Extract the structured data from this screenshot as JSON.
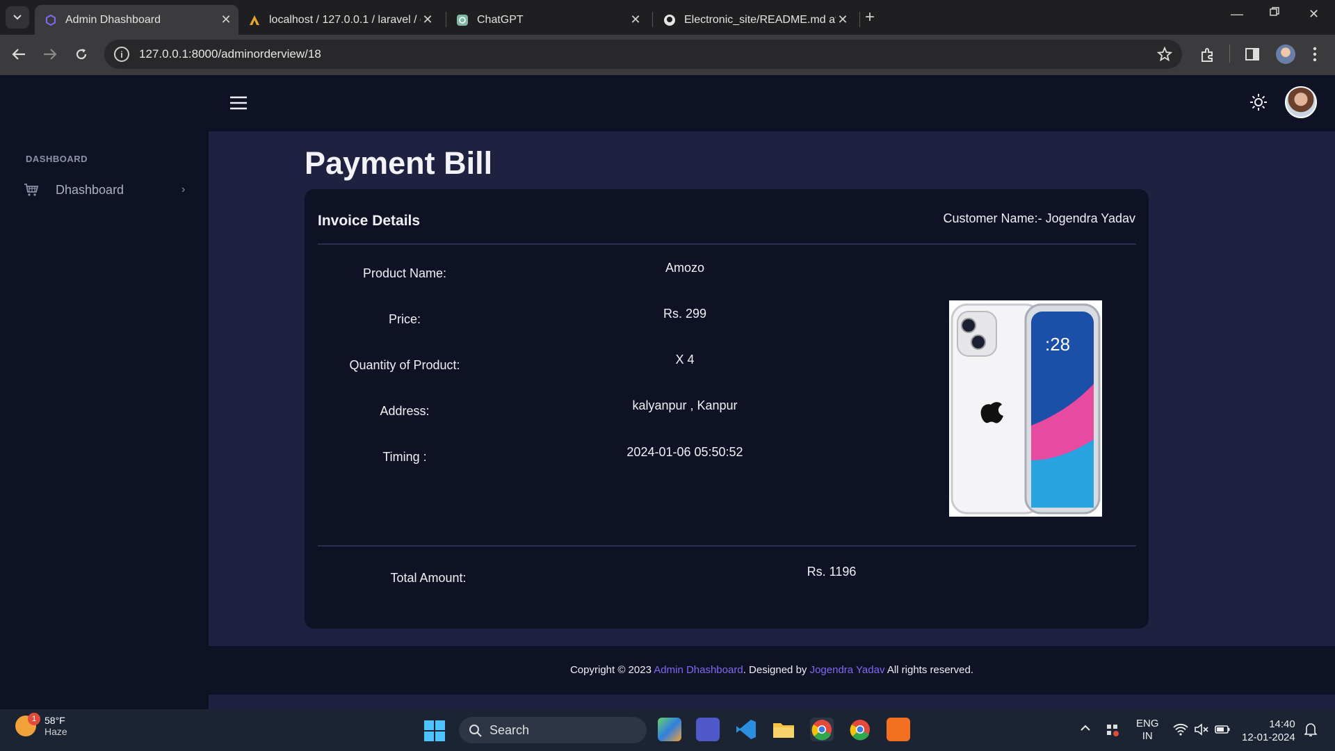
{
  "browser": {
    "tabs": [
      {
        "title": "Admin Dhashboard",
        "active": true
      },
      {
        "title": "localhost / 127.0.0.1 / laravel / c",
        "active": false
      },
      {
        "title": "ChatGPT",
        "active": false
      },
      {
        "title": "Electronic_site/README.md at r",
        "active": false
      }
    ],
    "url": "127.0.0.1:8000/adminorderview/18"
  },
  "sidebar": {
    "heading": "DASHBOARD",
    "items": [
      {
        "label": "Dhashboard",
        "icon": "cart-icon"
      }
    ]
  },
  "page": {
    "title": "Payment Bill",
    "invoice_title": "Invoice Details",
    "customer": "Customer Name:- Jogendra Yadav",
    "fields": [
      {
        "label": "Product Name:",
        "value": "Amozo"
      },
      {
        "label": "Price:",
        "value": "Rs. 299"
      },
      {
        "label": "Quantity of Product:",
        "value": "X 4"
      },
      {
        "label": "Address:",
        "value": "kalyanpur , Kanpur"
      },
      {
        "label": "Timing :",
        "value": "2024-01-06 05:50:52"
      }
    ],
    "total_label": "Total Amount:",
    "total_value": "Rs. 1196"
  },
  "footer": {
    "prefix": "Copyright © 2023",
    "brand": "Admin Dhashboard",
    "middle": ". Designed by",
    "author": "Jogendra Yadav",
    "suffix": "All rights reserved."
  },
  "taskbar": {
    "weather_temp": "58°F",
    "weather_desc": "Haze",
    "weather_badge": "1",
    "search": "Search",
    "lang1": "ENG",
    "lang2": "IN",
    "time": "14:40",
    "date": "12-01-2024"
  },
  "colors": {
    "accent": "#7d6bf0",
    "bg": "#0f1225",
    "content_bg": "#1f2140"
  }
}
